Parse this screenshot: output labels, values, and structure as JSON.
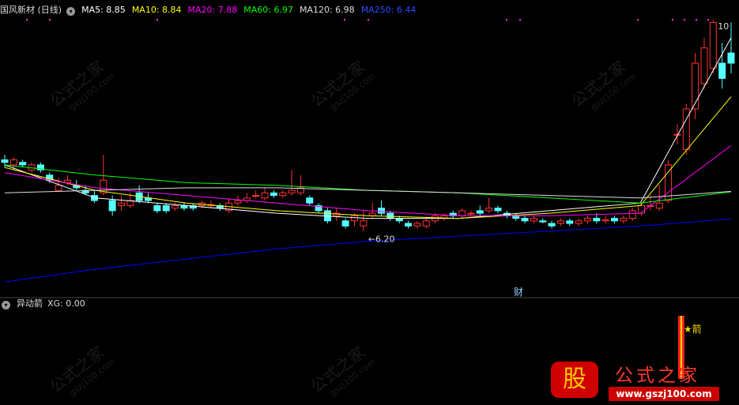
{
  "main_legend": {
    "title": "国风新材 (日线)",
    "items": [
      {
        "label": "MA5: 8.85",
        "color": "#ffffff"
      },
      {
        "label": "MA10: 8.84",
        "color": "#ffff00"
      },
      {
        "label": "MA20: 7.88",
        "color": "#ff00ff"
      },
      {
        "label": "MA60: 6.97",
        "color": "#00ff00"
      },
      {
        "label": "MA120: 6.98",
        "color": "#dddddd"
      },
      {
        "label": "MA250: 6.44",
        "color": "#0000ff"
      }
    ]
  },
  "sub_legend": {
    "title": "异动箭",
    "value": "XG: 0.00"
  },
  "annotations": {
    "low_label": "6.20",
    "high_label": "10",
    "fin_marker": "财",
    "arrow_marker": "★箭"
  },
  "watermark": {
    "cn": "公式之家",
    "url": "gszj100.com"
  },
  "logo": {
    "gu": "股",
    "text": "公式之家",
    "url": "www.gszj100.com"
  },
  "chart_data": {
    "type": "candlestick",
    "price_range": [
      5.0,
      10.4
    ],
    "candles": [
      [
        7.6,
        7.55,
        7.7,
        7.45
      ],
      [
        7.5,
        7.6,
        7.65,
        7.4
      ],
      [
        7.55,
        7.5,
        7.6,
        7.45
      ],
      [
        7.4,
        7.5,
        7.55,
        7.35
      ],
      [
        7.5,
        7.4,
        7.55,
        7.35
      ],
      [
        7.3,
        7.2,
        7.35,
        7.15
      ],
      [
        7.0,
        7.1,
        7.25,
        7.0
      ],
      [
        7.15,
        7.2,
        7.3,
        7.1
      ],
      [
        7.1,
        7.05,
        7.2,
        7.0
      ],
      [
        7.0,
        6.95,
        7.1,
        6.9
      ],
      [
        6.9,
        6.8,
        7.0,
        6.75
      ],
      [
        6.95,
        7.2,
        7.7,
        6.9
      ],
      [
        6.8,
        6.6,
        6.9,
        6.5
      ],
      [
        6.7,
        6.75,
        6.9,
        6.6
      ],
      [
        6.7,
        6.8,
        6.95,
        6.65
      ],
      [
        6.95,
        6.8,
        7.1,
        6.75
      ],
      [
        6.85,
        6.8,
        6.95,
        6.75
      ],
      [
        6.7,
        6.6,
        6.75,
        6.55
      ],
      [
        6.7,
        6.6,
        6.75,
        6.55
      ],
      [
        6.65,
        6.7,
        6.75,
        6.6
      ],
      [
        6.7,
        6.65,
        6.75,
        6.6
      ],
      [
        6.7,
        6.65,
        6.75,
        6.6
      ],
      [
        6.7,
        6.75,
        6.8,
        6.65
      ],
      [
        6.7,
        6.72,
        6.8,
        6.65
      ],
      [
        6.7,
        6.65,
        6.75,
        6.6
      ],
      [
        6.6,
        6.75,
        6.85,
        6.55
      ],
      [
        6.75,
        6.8,
        6.9,
        6.7
      ],
      [
        6.8,
        6.85,
        6.95,
        6.75
      ],
      [
        6.9,
        6.9,
        7.0,
        6.85
      ],
      [
        6.85,
        6.95,
        7.05,
        6.8
      ],
      [
        6.95,
        6.9,
        7.0,
        6.85
      ],
      [
        6.9,
        6.95,
        7.0,
        6.85
      ],
      [
        6.95,
        7.0,
        7.4,
        6.9
      ],
      [
        6.95,
        7.05,
        7.3,
        6.9
      ],
      [
        6.85,
        6.75,
        6.9,
        6.7
      ],
      [
        6.7,
        6.6,
        6.75,
        6.55
      ],
      [
        6.6,
        6.4,
        6.65,
        6.35
      ],
      [
        6.5,
        6.55,
        6.65,
        6.4
      ],
      [
        6.4,
        6.3,
        6.45,
        6.25
      ],
      [
        6.4,
        6.5,
        6.55,
        6.3
      ],
      [
        6.3,
        6.4,
        6.6,
        6.2
      ],
      [
        6.5,
        6.55,
        6.75,
        6.45
      ],
      [
        6.65,
        6.55,
        6.8,
        6.5
      ],
      [
        6.55,
        6.45,
        6.6,
        6.4
      ],
      [
        6.45,
        6.4,
        6.5,
        6.35
      ],
      [
        6.35,
        6.3,
        6.4,
        6.25
      ],
      [
        6.3,
        6.35,
        6.4,
        6.25
      ],
      [
        6.3,
        6.4,
        6.45,
        6.25
      ],
      [
        6.4,
        6.5,
        6.55,
        6.35
      ],
      [
        6.45,
        6.5,
        6.55,
        6.4
      ],
      [
        6.55,
        6.5,
        6.6,
        6.45
      ],
      [
        6.5,
        6.6,
        6.65,
        6.45
      ],
      [
        6.55,
        6.55,
        6.6,
        6.5
      ],
      [
        6.6,
        6.55,
        6.7,
        6.5
      ],
      [
        6.6,
        6.65,
        6.85,
        6.55
      ],
      [
        6.65,
        6.6,
        6.7,
        6.55
      ],
      [
        6.55,
        6.5,
        6.6,
        6.45
      ],
      [
        6.5,
        6.45,
        6.55,
        6.4
      ],
      [
        6.45,
        6.4,
        6.5,
        6.35
      ],
      [
        6.4,
        6.45,
        6.5,
        6.35
      ],
      [
        6.4,
        6.38,
        6.45,
        6.35
      ],
      [
        6.35,
        6.3,
        6.4,
        6.25
      ],
      [
        6.35,
        6.4,
        6.45,
        6.3
      ],
      [
        6.4,
        6.35,
        6.45,
        6.3
      ],
      [
        6.35,
        6.4,
        6.45,
        6.3
      ],
      [
        6.4,
        6.45,
        6.5,
        6.35
      ],
      [
        6.45,
        6.4,
        6.55,
        6.35
      ],
      [
        6.4,
        6.42,
        6.5,
        6.35
      ],
      [
        6.45,
        6.4,
        6.5,
        6.35
      ],
      [
        6.4,
        6.45,
        6.5,
        6.35
      ],
      [
        6.45,
        6.6,
        6.65,
        6.4
      ],
      [
        6.55,
        6.7,
        6.75,
        6.5
      ],
      [
        6.7,
        6.7,
        6.9,
        6.6
      ],
      [
        6.65,
        6.75,
        7.1,
        6.6
      ],
      [
        6.8,
        7.5,
        7.6,
        6.75
      ],
      [
        8.1,
        8.1,
        8.3,
        7.9
      ],
      [
        7.8,
        8.6,
        8.7,
        7.7
      ],
      [
        8.6,
        9.5,
        9.7,
        8.4
      ],
      [
        9.1,
        9.8,
        10.0,
        9.0
      ],
      [
        9.4,
        10.3,
        10.35,
        9.3
      ],
      [
        9.5,
        9.2,
        9.9,
        9.0
      ],
      [
        9.7,
        9.5,
        10.3,
        9.3
      ]
    ],
    "ma": [
      {
        "name": "MA5",
        "color": "#ffffff",
        "values": [
          7.5,
          6.85,
          6.7,
          6.55,
          6.45,
          6.45,
          6.6,
          6.75,
          10.0
        ]
      },
      {
        "name": "MA10",
        "color": "#ffff00",
        "values": [
          7.45,
          7.0,
          6.75,
          6.6,
          6.5,
          6.45,
          6.55,
          6.7,
          8.84
        ]
      },
      {
        "name": "MA20",
        "color": "#ff00ff",
        "values": [
          7.35,
          7.05,
          6.9,
          6.75,
          6.6,
          6.5,
          6.5,
          6.55,
          7.88
        ]
      },
      {
        "name": "MA60",
        "color": "#00ff00",
        "values": [
          7.5,
          7.3,
          7.15,
          7.1,
          7.0,
          6.95,
          6.85,
          6.75,
          6.97
        ]
      },
      {
        "name": "MA120",
        "color": "#dddddd",
        "values": [
          6.95,
          7.0,
          7.05,
          7.05,
          7.0,
          6.95,
          6.9,
          6.85,
          6.98
        ]
      },
      {
        "name": "MA250",
        "color": "#0000ff",
        "values": [
          5.2,
          5.45,
          5.65,
          5.85,
          6.0,
          6.1,
          6.2,
          6.3,
          6.44
        ]
      }
    ],
    "signal": {
      "name": "XG",
      "value": 0.0,
      "fired_at_index": 75
    }
  }
}
